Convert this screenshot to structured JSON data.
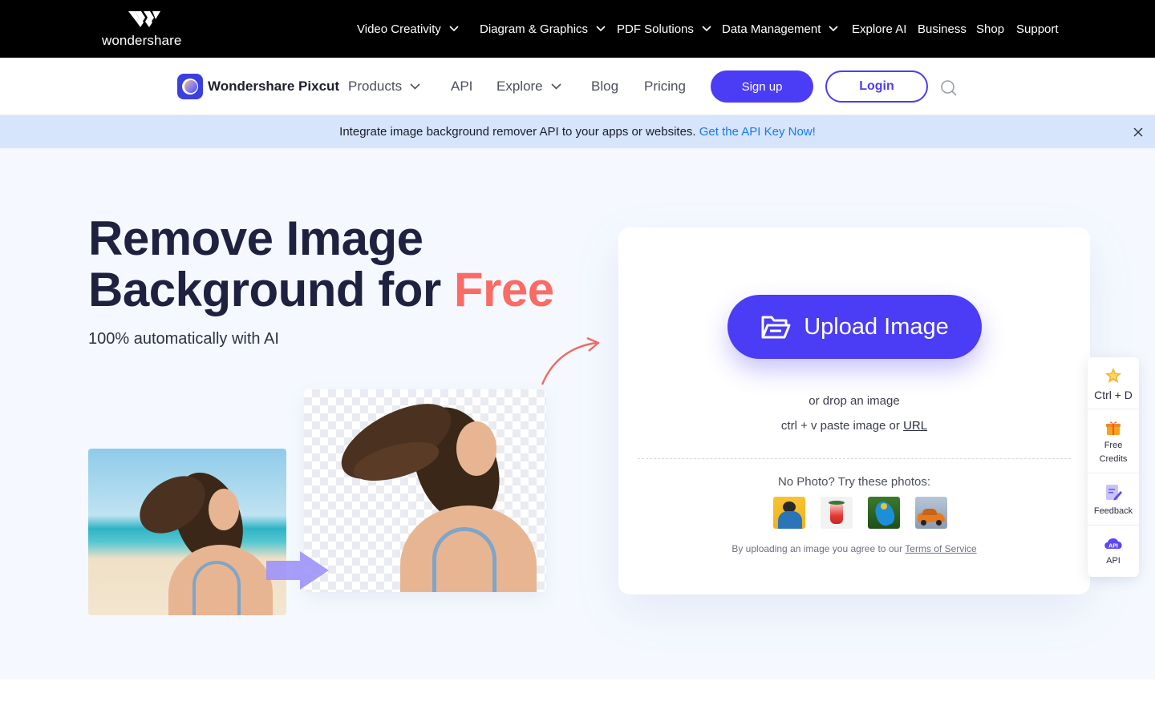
{
  "global_nav": {
    "brand": "wondershare",
    "items": [
      {
        "label": "Video Creativity",
        "has_dropdown": true
      },
      {
        "label": "Diagram & Graphics",
        "has_dropdown": true
      },
      {
        "label": "PDF Solutions",
        "has_dropdown": true
      },
      {
        "label": "Data Management",
        "has_dropdown": true
      },
      {
        "label": "Explore AI",
        "has_dropdown": false
      },
      {
        "label": "Business",
        "has_dropdown": false
      },
      {
        "label": "Shop",
        "has_dropdown": false
      },
      {
        "label": "Support",
        "has_dropdown": false
      }
    ]
  },
  "product_nav": {
    "product_name": "Wondershare Pixcut",
    "items": [
      {
        "label": "Products",
        "has_dropdown": true
      },
      {
        "label": "API",
        "has_dropdown": false
      },
      {
        "label": "Explore",
        "has_dropdown": true
      },
      {
        "label": "Blog",
        "has_dropdown": false
      },
      {
        "label": "Pricing",
        "has_dropdown": false
      }
    ],
    "signup_label": "Sign up",
    "login_label": "Login",
    "search_icon": "search-icon"
  },
  "banner": {
    "text": "Integrate image background remover API to your apps or websites.",
    "link": "Get the API Key Now!"
  },
  "hero": {
    "title_line1": "Remove Image",
    "title_line2_main": "Background for ",
    "title_line2_accent": "Free",
    "subtitle": "100% automatically with AI"
  },
  "upload": {
    "button_label": "Upload Image",
    "drop_text": "or drop an image",
    "paste_text": "ctrl + v paste image or ",
    "paste_link": "URL",
    "try_text": "No Photo? Try these photos:",
    "sample_photos": [
      "man-photo",
      "drink-photo",
      "parrot-photo",
      "car-photo"
    ],
    "terms_text": "By uploading an image you agree to our ",
    "terms_link": "Terms of Service"
  },
  "side_tools": [
    {
      "label": "Ctrl + D",
      "icon": "star-icon"
    },
    {
      "label": "Free Credits",
      "icon": "gift-icon"
    },
    {
      "label": "Feedback",
      "icon": "feedback-icon"
    },
    {
      "label": "API",
      "icon": "api-icon"
    }
  ],
  "colors": {
    "brand": "#4b3cf5",
    "accent": "#fa6b65",
    "banner_bg": "#d6e5fb",
    "hero_bg": "#f5f9ff",
    "link": "#1677ff"
  }
}
